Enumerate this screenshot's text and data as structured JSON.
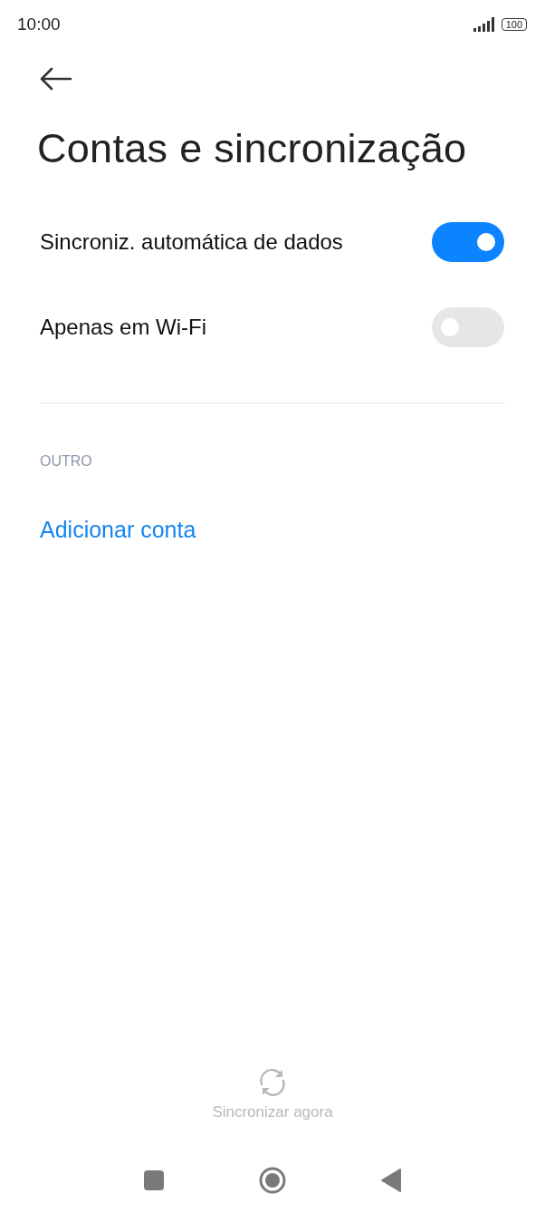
{
  "status_bar": {
    "time": "10:00",
    "battery": "100"
  },
  "title": "Contas e sincronização",
  "settings": [
    {
      "label": "Sincroniz. automática de dados",
      "on": true
    },
    {
      "label": "Apenas em Wi-Fi",
      "on": false
    }
  ],
  "section": {
    "header": "OUTRO",
    "link": "Adicionar conta"
  },
  "sync_now": {
    "label": "Sincronizar agora",
    "disabled": true
  }
}
